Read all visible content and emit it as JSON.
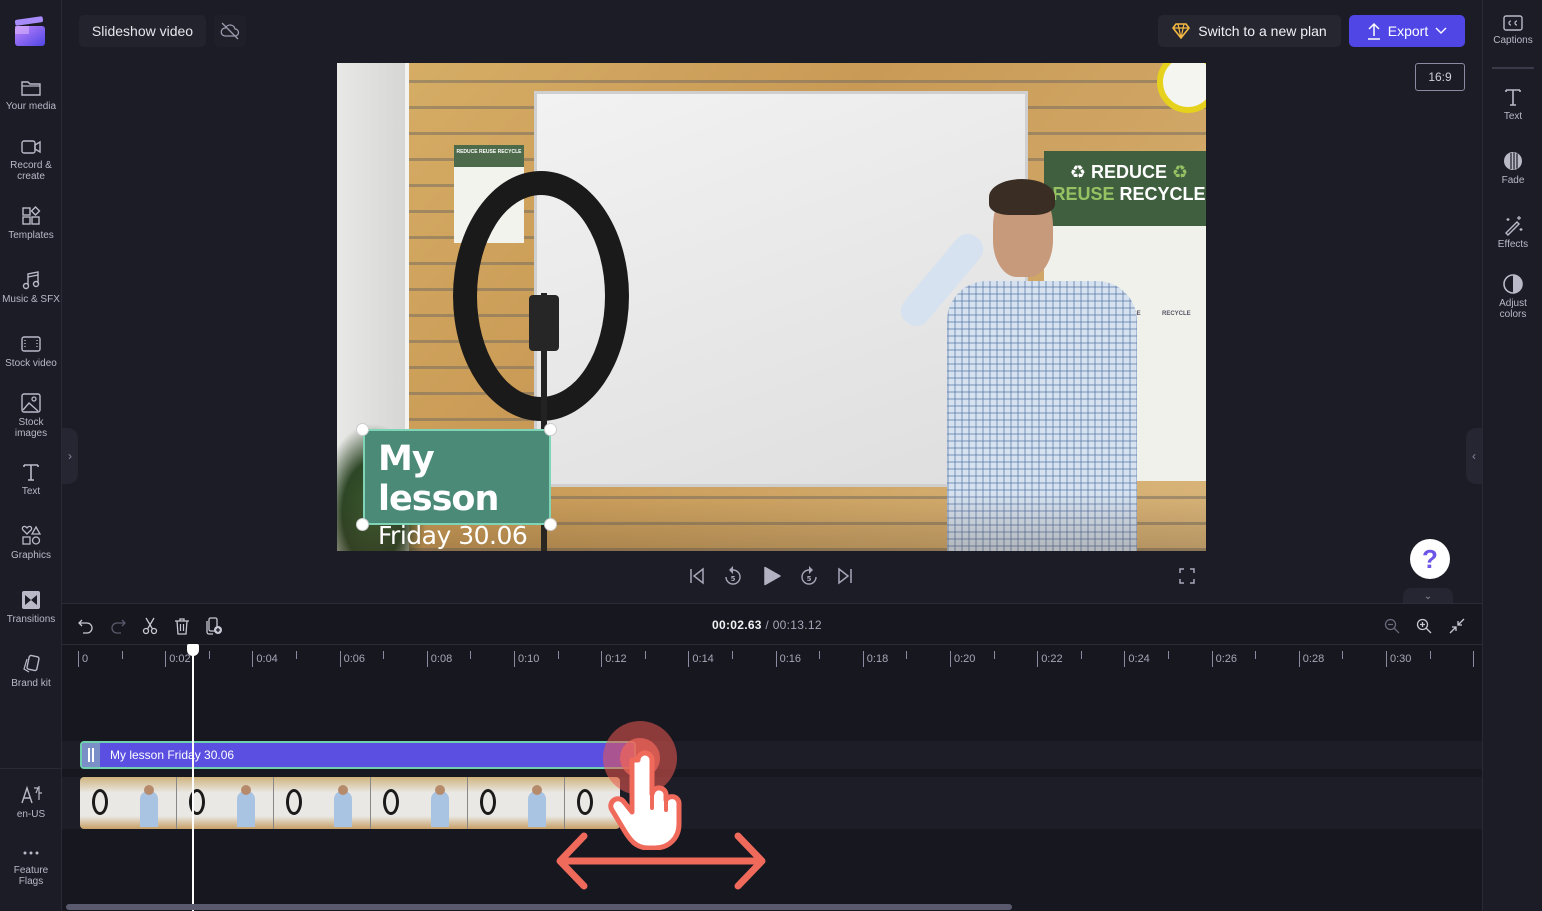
{
  "app": {
    "project_title": "Slideshow video",
    "cloud_status_icon": "cloud-off-icon"
  },
  "header": {
    "plan_button": "Switch to a new plan",
    "export_button": "Export",
    "aspect_ratio": "16:9"
  },
  "left_sidebar": {
    "items": [
      {
        "label": "Your media",
        "icon": "folder-icon"
      },
      {
        "label": "Record &",
        "label2": "create",
        "icon": "camera-icon"
      },
      {
        "label": "Templates",
        "icon": "templates-icon"
      },
      {
        "label": "Music & SFX",
        "icon": "music-icon"
      },
      {
        "label": "Stock video",
        "icon": "film-icon"
      },
      {
        "label": "Stock",
        "label2": "images",
        "icon": "image-icon"
      },
      {
        "label": "Text",
        "icon": "text-icon"
      },
      {
        "label": "Graphics",
        "icon": "shapes-icon"
      },
      {
        "label": "Transitions",
        "icon": "transitions-icon"
      },
      {
        "label": "Brand kit",
        "icon": "brand-kit-icon"
      }
    ],
    "bottom_items": [
      {
        "label": "en-US",
        "icon": "language-icon"
      },
      {
        "label": "Feature",
        "label2": "Flags",
        "icon": "more-icon"
      }
    ]
  },
  "right_sidebar": {
    "items": [
      {
        "label": "Captions",
        "icon": "captions-icon"
      },
      {
        "label": "Text",
        "icon": "text-icon"
      },
      {
        "label": "Fade",
        "icon": "fade-icon"
      },
      {
        "label": "Effects",
        "icon": "effects-icon"
      },
      {
        "label": "Adjust",
        "label2": "colors",
        "icon": "adjust-colors-icon"
      }
    ]
  },
  "preview": {
    "overlay_title": "My lesson",
    "overlay_subtitle": "Friday 30.06",
    "poster_line1": "REDUCE",
    "poster_line2a": "REUSE",
    "poster_line2b": "RECYCLE",
    "poster_label_reuse": "REUSE",
    "poster_label_recycle": "RECYCLE",
    "small_poster_text": "REDUCE REUSE RECYCLE"
  },
  "player": {
    "skip_seconds": "5",
    "help_label": "?"
  },
  "timeline": {
    "current_time": "00:02.63",
    "separator": " / ",
    "total_time": "00:13.12",
    "ruler_labels": [
      "0",
      "0:02",
      "0:04",
      "0:06",
      "0:08",
      "0:10",
      "0:12",
      "0:14",
      "0:16",
      "0:18",
      "0:20",
      "0:22",
      "0:24",
      "0:26",
      "0:28",
      "0:30"
    ],
    "text_clip_label": "My lesson Friday 30.06",
    "video_thumbnails": 6
  },
  "colors": {
    "accent": "#4f46e5",
    "text_clip": "#5a4fe0",
    "overlay_bg": "#4a8a77",
    "drag_hint": "#f06a5c"
  }
}
